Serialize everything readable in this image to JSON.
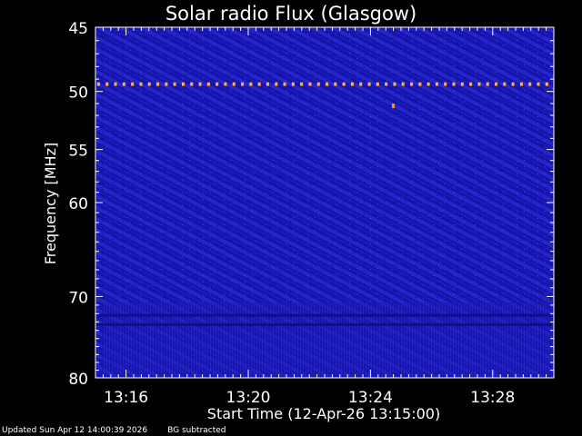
{
  "chart_data": {
    "type": "heatmap",
    "title": "Solar radio Flux (Glasgow)",
    "ylabel": "Frequency [MHz]",
    "xlabel": "Start Time (12-Apr-26 13:15:00)",
    "y_scale": "log",
    "ylim": [
      45,
      80
    ],
    "y_ticks": [
      45,
      50,
      55,
      60,
      70,
      80
    ],
    "y_tick_labels": [
      "45",
      "50",
      "55",
      "60",
      "70",
      "80"
    ],
    "x_ticks": [
      "13:16",
      "13:20",
      "13:24",
      "13:28"
    ],
    "x_tick_minutes": [
      16,
      20,
      24,
      28
    ],
    "xlim_minutes": [
      15,
      30
    ],
    "colormap": "blue-background",
    "features": [
      {
        "type": "horizontal_band",
        "frequency_mhz": 49.4,
        "description": "interference line"
      },
      {
        "type": "point",
        "time_minute": 24.75,
        "frequency_mhz": 51.2
      },
      {
        "type": "horizontal_band",
        "frequency_mhz": 72.2
      },
      {
        "type": "horizontal_band",
        "frequency_mhz": 73.3
      }
    ]
  },
  "footer": {
    "updated": "Updated Sun Apr 12 14:00:39 2026",
    "mode": "BG subtracted"
  },
  "colors": {
    "background": "#000000",
    "plot_base": "#1a1ab5",
    "band": "#ffaa22",
    "point": "#ff9a00",
    "axis": "#ffffff"
  }
}
